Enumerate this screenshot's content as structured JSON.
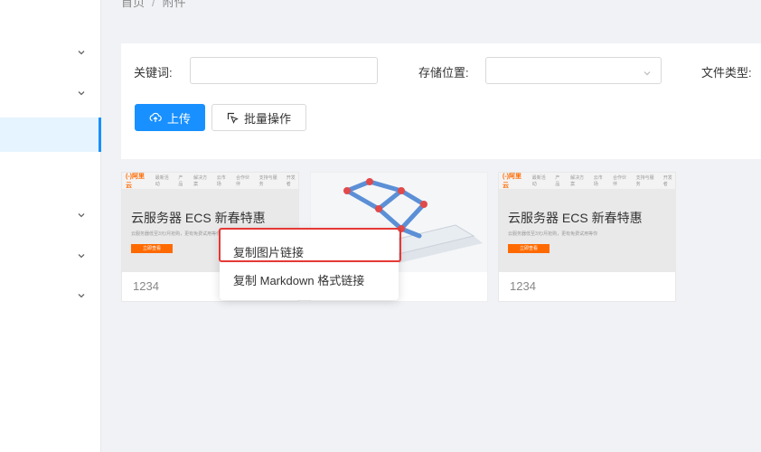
{
  "breadcrumb": {
    "home": "首页",
    "separator": "/",
    "current": "附件"
  },
  "filter": {
    "keyword_label": "关键词:",
    "keyword_value": "",
    "storage_label": "存储位置:",
    "storage_value": "",
    "filetype_label": "文件类型:"
  },
  "actions": {
    "upload_label": "上传",
    "batch_label": "批量操作"
  },
  "cards": [
    {
      "caption": "1234",
      "image": {
        "logo": "(-)阿里云",
        "nav": [
          "最新活动",
          "产品",
          "解决方案",
          "云市场",
          "合作伙伴",
          "支持与服务",
          "开发者"
        ],
        "title": "云服务器 ECS 新春特惠",
        "subtitle": "云服务器低至3元/月抢购，更有免费试用等你",
        "cta": "立即查看"
      }
    },
    {
      "caption": ""
    },
    {
      "caption": "1234",
      "image": {
        "logo": "(-)阿里云",
        "nav": [
          "最新活动",
          "产品",
          "解决方案",
          "云市场",
          "合作伙伴",
          "支持与服务",
          "开发者"
        ],
        "title": "云服务器 ECS 新春特惠",
        "subtitle": "云服务器低至3元/月抢购，更有免费试用等你",
        "cta": "立即查看"
      }
    }
  ],
  "context_menu": {
    "copy_image_link": "复制图片链接",
    "copy_markdown_link": "复制 Markdown 格式链接"
  },
  "colors": {
    "primary": "#1890ff",
    "highlight": "#e53935",
    "brand": "#ff6a00"
  },
  "icons": [
    "chevron-down-icon",
    "upload-icon",
    "select-icon"
  ]
}
